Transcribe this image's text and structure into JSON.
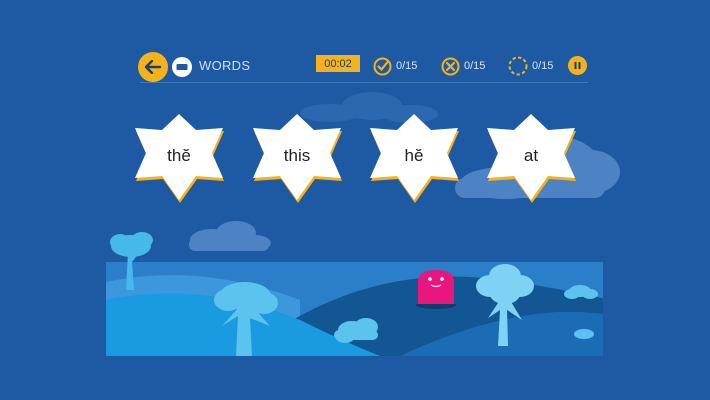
{
  "header": {
    "mode_label": "WORDS",
    "timer": "00:02",
    "correct": "0/15",
    "wrong": "0/15",
    "remaining": "0/15"
  },
  "words": [
    "thĕ",
    "this",
    "hĕ",
    "at"
  ],
  "colors": {
    "background": "#1d5aa3",
    "accent": "#f6b21b",
    "star_fill": "#ffffff",
    "star_shadow": "#f6b21b",
    "character": "#e9167e"
  },
  "icons": {
    "back": "arrow-left-icon",
    "mode": "keyboard-icon",
    "correct": "check-circle-icon",
    "wrong": "x-circle-icon",
    "remaining": "dashed-circle-icon",
    "pause": "pause-icon"
  }
}
